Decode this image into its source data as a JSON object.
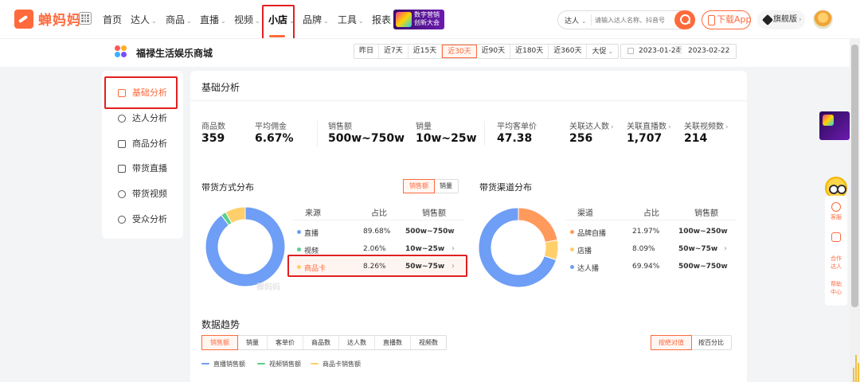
{
  "brand": {
    "name": "蝉妈妈"
  },
  "nav": {
    "items": [
      {
        "label": "首页",
        "arrow": ""
      },
      {
        "label": "达人",
        "arrow": "⌄"
      },
      {
        "label": "商品",
        "arrow": "⌄"
      },
      {
        "label": "直播",
        "arrow": "⌄"
      },
      {
        "label": "视频",
        "arrow": "⌄"
      },
      {
        "label": "小店",
        "arrow": "⌄"
      },
      {
        "label": "品牌",
        "arrow": "⌄"
      },
      {
        "label": "工具",
        "arrow": "⌄"
      },
      {
        "label": "报表",
        "arrow": ""
      }
    ],
    "active": "小店",
    "banner": {
      "line1": "数字营销",
      "line2": "创新大会"
    }
  },
  "search": {
    "type_label": "达人",
    "placeholder": "请输入达人名称、抖音号"
  },
  "header_buttons": {
    "download": "下载App",
    "flagship": "旗舰版",
    "flagship_arrow": "›"
  },
  "shop": {
    "name": "福禄生活娱乐商城"
  },
  "date_ranges": {
    "options": [
      "昨日",
      "近7天",
      "近15天",
      "近30天",
      "近90天",
      "近180天",
      "近360天",
      "大促"
    ],
    "active": "近30天",
    "start": "2023-01-24",
    "separator": "至",
    "end": "2023-02-22"
  },
  "sidebar": {
    "items": [
      {
        "label": "基础分析",
        "icon": "chart-icon"
      },
      {
        "label": "达人分析",
        "icon": "person-icon"
      },
      {
        "label": "商品分析",
        "icon": "bag-icon"
      },
      {
        "label": "带货直播",
        "icon": "tv-icon"
      },
      {
        "label": "带货视频",
        "icon": "play-icon"
      },
      {
        "label": "受众分析",
        "icon": "audience-icon"
      }
    ],
    "active": "基础分析"
  },
  "main": {
    "title": "基础分析",
    "stats": [
      {
        "label": "商品数",
        "value": "359",
        "link": false
      },
      {
        "label": "平均佣金",
        "value": "6.67%",
        "link": false
      },
      {
        "label": "销售额",
        "value": "500w~750w",
        "link": false
      },
      {
        "label": "销量",
        "value": "10w~25w",
        "link": false
      },
      {
        "label": "平均客单价",
        "value": "47.38",
        "link": false
      },
      {
        "label": "关联达人数",
        "value": "256",
        "link": true
      },
      {
        "label": "关联直播数",
        "value": "1,707",
        "link": true
      },
      {
        "label": "关联视频数",
        "value": "214",
        "link": true
      }
    ],
    "link_arrow": "›",
    "method_dist": {
      "title": "带货方式分布",
      "toggle": [
        "销售额",
        "销量"
      ],
      "toggle_active": "销售额",
      "headers": [
        "来源",
        "占比",
        "销售额"
      ],
      "rows": [
        {
          "name": "直播",
          "share": "89.68%",
          "sales": "500w~750w",
          "color": "#6e9ef5"
        },
        {
          "name": "视频",
          "share": "2.06%",
          "sales": "10w~25w",
          "color": "#5ad08a"
        },
        {
          "name": "商品卡",
          "share": "8.26%",
          "sales": "50w~75w",
          "color": "#ffcf6b"
        }
      ]
    },
    "channel_dist": {
      "title": "带货渠道分布",
      "headers": [
        "渠道",
        "占比",
        "销售额"
      ],
      "rows": [
        {
          "name": "品牌自播",
          "share": "21.97%",
          "sales": "100w~250w",
          "color": "#ff9a5c"
        },
        {
          "name": "店播",
          "share": "8.09%",
          "sales": "50w~75w",
          "color": "#ffcf6b"
        },
        {
          "name": "达人播",
          "share": "69.94%",
          "sales": "500w~750w",
          "color": "#6e9ef5"
        }
      ]
    },
    "trend": {
      "title": "数据趋势",
      "tabs": [
        "销售额",
        "销量",
        "客单价",
        "商品数",
        "达人数",
        "直播数",
        "视频数"
      ],
      "tab_active": "销售额",
      "mode": [
        "按绝对值",
        "按百分比"
      ],
      "mode_active": "按绝对值",
      "legend": [
        {
          "label": "直播销售额",
          "color": "#6e9ef5"
        },
        {
          "label": "视频销售额",
          "color": "#5ad08a"
        },
        {
          "label": "商品卡销售额",
          "color": "#ffcf6b"
        }
      ]
    },
    "watermark": "蝉妈妈"
  },
  "float_panel": {
    "items": [
      "客服",
      "合作\n达人",
      "帮助\n中心"
    ]
  },
  "chart_data": [
    {
      "type": "pie",
      "title": "带货方式分布",
      "categories": [
        "直播",
        "视频",
        "商品卡"
      ],
      "values": [
        89.68,
        2.06,
        8.26
      ],
      "colors": [
        "#6e9ef5",
        "#5ad08a",
        "#ffcf6b"
      ]
    },
    {
      "type": "pie",
      "title": "带货渠道分布",
      "categories": [
        "品牌自播",
        "店播",
        "达人播"
      ],
      "values": [
        21.97,
        8.09,
        69.94
      ],
      "colors": [
        "#ff9a5c",
        "#ffcf6b",
        "#6e9ef5"
      ]
    }
  ]
}
